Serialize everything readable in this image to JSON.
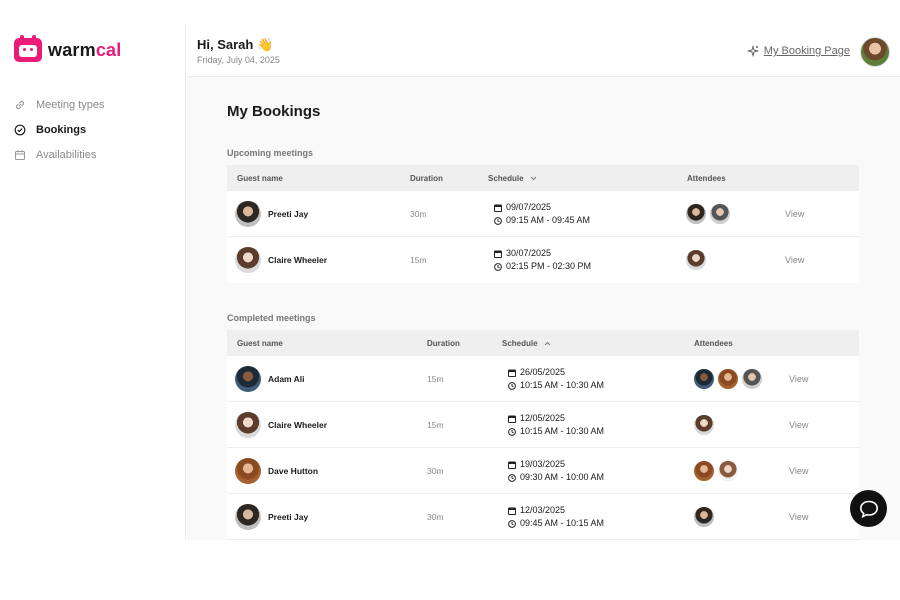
{
  "app": {
    "logo_warm": "warm",
    "logo_cal": "cal",
    "brand_color": "#ec1a78"
  },
  "sidebar": {
    "items": [
      {
        "label": "Meeting types",
        "icon": "link-icon",
        "active": false
      },
      {
        "label": "Bookings",
        "icon": "check-circle-icon",
        "active": true
      },
      {
        "label": "Availabilities",
        "icon": "calendar-icon",
        "active": false
      }
    ]
  },
  "header": {
    "greeting": "Hi, Sarah 👋",
    "date": "Friday, July 04, 2025",
    "booking_page_link": "My Booking Page"
  },
  "main": {
    "title": "My Bookings",
    "upcoming": {
      "title": "Upcoming meetings",
      "columns": [
        "Guest name",
        "Duration",
        "Schedule",
        "Attendees"
      ],
      "rows": [
        {
          "name": "Preeti Jay",
          "duration": "30m",
          "date": "09/07/2025",
          "time": "09:15 AM - 09:45 AM",
          "view": "View"
        },
        {
          "name": "Claire Wheeler",
          "duration": "15m",
          "date": "30/07/2025",
          "time": "02:15 PM - 02:30 PM",
          "view": "View"
        }
      ]
    },
    "completed": {
      "title": "Completed meetings",
      "columns": [
        "Guest name",
        "Duration",
        "Schedule",
        "Attendees"
      ],
      "rows": [
        {
          "name": "Adam Ali",
          "duration": "15m",
          "date": "26/05/2025",
          "time": "10:15 AM - 10:30 AM",
          "view": "View"
        },
        {
          "name": "Claire Wheeler",
          "duration": "15m",
          "date": "12/05/2025",
          "time": "10:15 AM - 10:30 AM",
          "view": "View"
        },
        {
          "name": "Dave Hutton",
          "duration": "30m",
          "date": "19/03/2025",
          "time": "09:30 AM - 10:00 AM",
          "view": "View"
        },
        {
          "name": "Preeti Jay",
          "duration": "30m",
          "date": "12/03/2025",
          "time": "09:45 AM - 10:15 AM",
          "view": "View"
        }
      ]
    }
  },
  "chat": {
    "icon": "chat-bubble-icon"
  }
}
